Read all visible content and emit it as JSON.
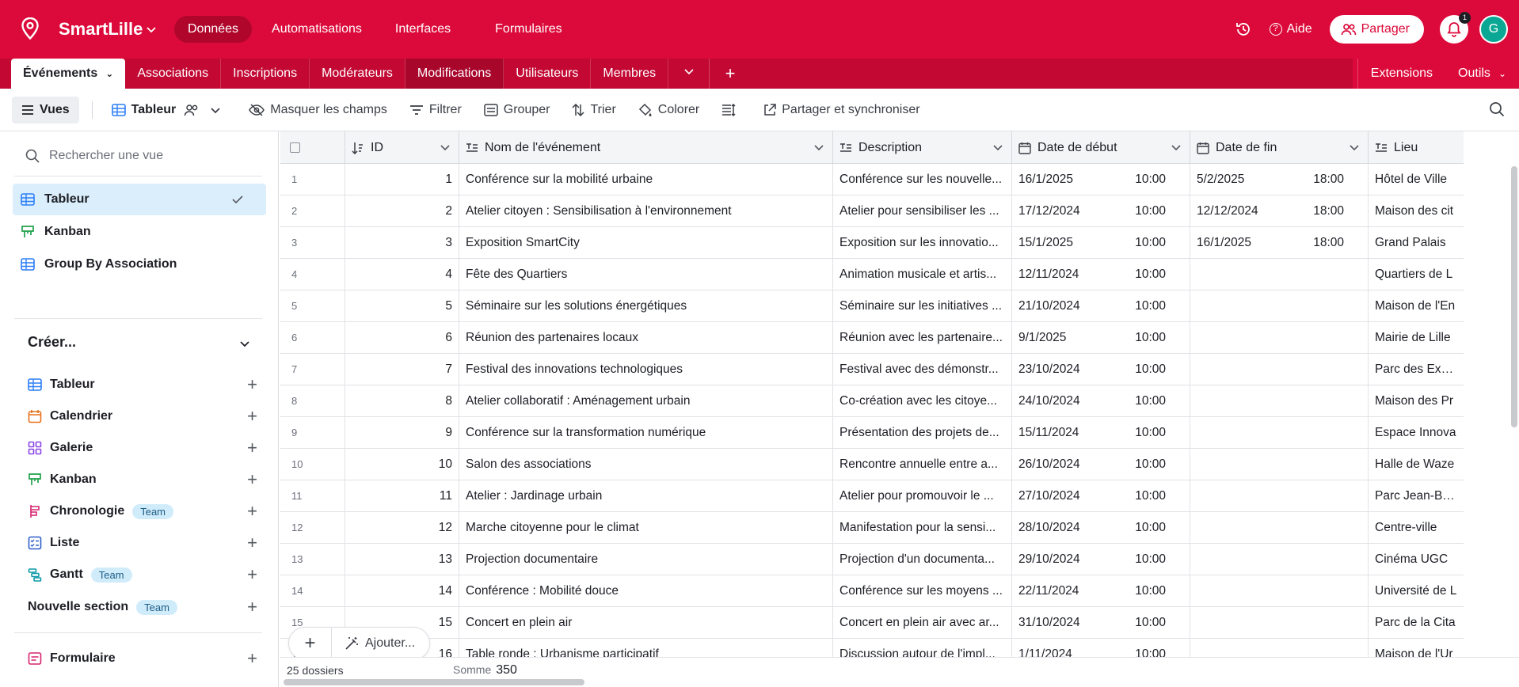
{
  "app": {
    "name": "SmartLille"
  },
  "topnav": [
    {
      "label": "Données",
      "active": true
    },
    {
      "label": "Automatisations",
      "active": false
    },
    {
      "label": "Interfaces",
      "active": false
    },
    {
      "label": "Formulaires",
      "active": false
    }
  ],
  "header": {
    "help_label": "Aide",
    "share_label": "Partager",
    "notif_count": "1",
    "avatar_letter": "G"
  },
  "tabs": {
    "items": [
      "Événements",
      "Associations",
      "Inscriptions",
      "Modérateurs",
      "Modifications",
      "Utilisateurs",
      "Membres"
    ],
    "extensions": "Extensions",
    "tools": "Outils"
  },
  "toolbar": {
    "views": "Vues",
    "view_name": "Tableur",
    "hide_fields": "Masquer les champs",
    "filter": "Filtrer",
    "group": "Grouper",
    "sort": "Trier",
    "color": "Colorer",
    "share_sync": "Partager et synchroniser"
  },
  "sidebar": {
    "search_placeholder": "Rechercher une vue",
    "views": [
      "Tableur",
      "Kanban",
      "Group By Association"
    ],
    "create_heading": "Créer...",
    "create_items": [
      {
        "label": "Tableur",
        "badge": ""
      },
      {
        "label": "Calendrier",
        "badge": ""
      },
      {
        "label": "Galerie",
        "badge": ""
      },
      {
        "label": "Kanban",
        "badge": ""
      },
      {
        "label": "Chronologie",
        "badge": "Team"
      },
      {
        "label": "Liste",
        "badge": ""
      },
      {
        "label": "Gantt",
        "badge": "Team"
      },
      {
        "label": "Nouvelle section",
        "badge": "Team"
      },
      {
        "label": "Formulaire",
        "badge": ""
      }
    ]
  },
  "grid": {
    "columns": [
      "ID",
      "Nom de l'événement",
      "Description",
      "Date de début",
      "Date de fin",
      "Lieu"
    ],
    "rows": [
      [
        "1",
        "1",
        "Conférence sur la mobilité urbaine",
        "Conférence sur les nouvelle...",
        "16/1/2025",
        "10:00",
        "5/2/2025",
        "18:00",
        "Hôtel de Ville"
      ],
      [
        "2",
        "2",
        "Atelier citoyen : Sensibilisation à l'environnement",
        "Atelier pour sensibiliser les ...",
        "17/12/2024",
        "10:00",
        "12/12/2024",
        "18:00",
        "Maison des cit"
      ],
      [
        "3",
        "3",
        "Exposition SmartCity",
        "Exposition sur les innovatio...",
        "15/1/2025",
        "10:00",
        "16/1/2025",
        "18:00",
        "Grand Palais"
      ],
      [
        "4",
        "4",
        "Fête des Quartiers",
        "Animation musicale et artis...",
        "12/11/2024",
        "10:00",
        "",
        "",
        "Quartiers de L"
      ],
      [
        "5",
        "5",
        "Séminaire sur les solutions énergétiques",
        "Séminaire sur les initiatives ...",
        "21/10/2024",
        "10:00",
        "",
        "",
        "Maison de l'En"
      ],
      [
        "6",
        "6",
        "Réunion des partenaires locaux",
        "Réunion avec les partenaire...",
        "9/1/2025",
        "10:00",
        "",
        "",
        "Mairie de Lille"
      ],
      [
        "7",
        "7",
        "Festival des innovations technologiques",
        "Festival avec des démonstr...",
        "23/10/2024",
        "10:00",
        "",
        "",
        "Parc des Expos"
      ],
      [
        "8",
        "8",
        "Atelier collaboratif : Aménagement urbain",
        "Co-création avec les citoye...",
        "24/10/2024",
        "10:00",
        "",
        "",
        "Maison des Pr"
      ],
      [
        "9",
        "9",
        "Conférence sur la transformation numérique",
        "Présentation des projets de...",
        "15/11/2024",
        "10:00",
        "",
        "",
        "Espace Innova"
      ],
      [
        "10",
        "10",
        "Salon des associations",
        "Rencontre annuelle entre a...",
        "26/10/2024",
        "10:00",
        "",
        "",
        "Halle de Waze"
      ],
      [
        "11",
        "11",
        "Atelier : Jardinage urbain",
        "Atelier pour promouvoir le ...",
        "27/10/2024",
        "10:00",
        "",
        "",
        "Parc Jean-Bapt"
      ],
      [
        "12",
        "12",
        "Marche citoyenne pour le climat",
        "Manifestation pour la sensi...",
        "28/10/2024",
        "10:00",
        "",
        "",
        "Centre-ville"
      ],
      [
        "13",
        "13",
        "Projection documentaire",
        "Projection d'un documenta...",
        "29/10/2024",
        "10:00",
        "",
        "",
        "Cinéma UGC"
      ],
      [
        "14",
        "14",
        "Conférence : Mobilité douce",
        "Conférence sur les moyens ...",
        "22/11/2024",
        "10:00",
        "",
        "",
        "Université de L"
      ],
      [
        "15",
        "15",
        "Concert en plein air",
        "Concert en plein air avec ar...",
        "31/10/2024",
        "10:00",
        "",
        "",
        "Parc de la Cita"
      ],
      [
        "16",
        "16",
        "Table ronde : Urbanisme participatif",
        "Discussion autour de l'impl...",
        "1/11/2024",
        "10:00",
        "",
        "",
        "Maison de l'Ur"
      ]
    ]
  },
  "footer": {
    "count": "25 dossiers",
    "sum_label": "Somme",
    "sum_value": "350",
    "add_label": "Ajouter..."
  },
  "colors": {
    "brand": "#dc0a3a",
    "tabstrip": "#c20833",
    "selected_view": "#dbeefc",
    "team_badge": "#d0ecfb"
  }
}
